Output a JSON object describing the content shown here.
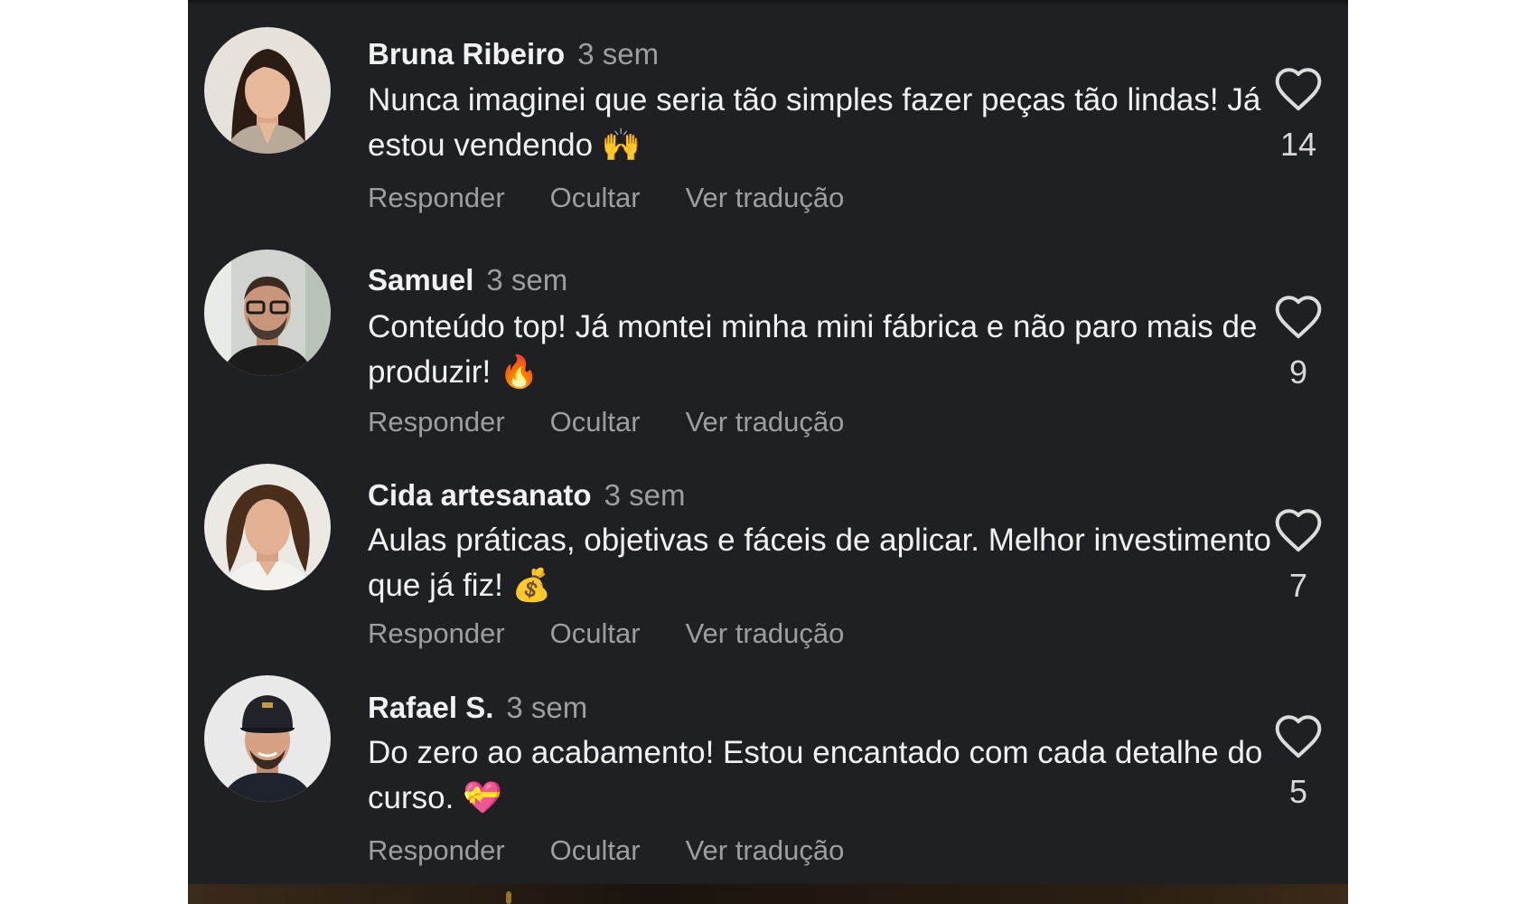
{
  "comments": [
    {
      "author": "Bruna Ribeiro",
      "time": "3 sem",
      "text": "Nunca imaginei que seria tão simples fazer peças tão lindas! Já estou vendendo 🙌",
      "actions": {
        "reply": "Responder",
        "hide": "Ocultar",
        "translate": "Ver tradução"
      },
      "likes": "14"
    },
    {
      "author": "Samuel",
      "time": "3 sem",
      "text": "Conteúdo top! Já montei minha mini fábrica e não paro mais de produzir! 🔥",
      "actions": {
        "reply": "Responder",
        "hide": "Ocultar",
        "translate": "Ver tradução"
      },
      "likes": "9"
    },
    {
      "author": "Cida artesanato",
      "time": "3 sem",
      "text": "Aulas práticas, objetivas e fáceis de aplicar. Melhor investimento que já fiz! 💰",
      "actions": {
        "reply": "Responder",
        "hide": "Ocultar",
        "translate": "Ver tradução"
      },
      "likes": "7"
    },
    {
      "author": "Rafael S.",
      "time": "3 sem",
      "text": "Do zero ao acabamento! Estou encantado com cada detalhe do curso. 💝",
      "actions": {
        "reply": "Responder",
        "hide": "Ocultar",
        "translate": "Ver tradução"
      },
      "likes": "5"
    }
  ],
  "icons": {
    "like": "heart-outline-icon"
  },
  "colors": {
    "background": "#1f2023",
    "text_primary": "#f2f2f2",
    "text_secondary": "#9d9ea3"
  }
}
